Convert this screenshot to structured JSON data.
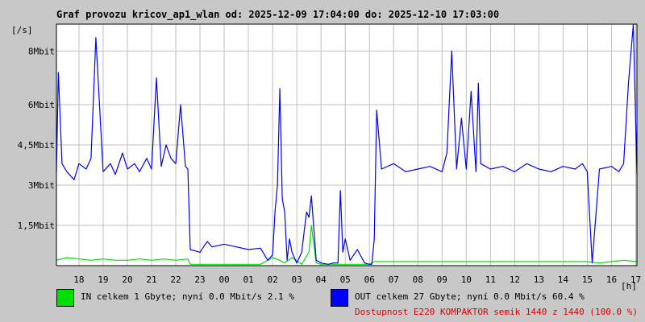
{
  "header": {
    "title": "Graf provozu kricov_ap1_wlan od: 2025-12-09 17:04:00 do: 2025-12-10 17:03:00"
  },
  "chart_data": {
    "type": "line",
    "ylabel": "[/s]",
    "xunit": "[h]",
    "ylim": [
      0,
      9
    ],
    "yticks": [
      {
        "value": 1.5,
        "label": "1,5Mbit"
      },
      {
        "value": 3,
        "label": "3Mbit"
      },
      {
        "value": 4.5,
        "label": "4,5Mbit"
      },
      {
        "value": 6,
        "label": "6Mbit"
      },
      {
        "value": 8,
        "label": "8Mbit"
      }
    ],
    "xlim": [
      17.07,
      41.05
    ],
    "xticks": [
      {
        "value": 18,
        "label": "18"
      },
      {
        "value": 19,
        "label": "19"
      },
      {
        "value": 20,
        "label": "20"
      },
      {
        "value": 21,
        "label": "21"
      },
      {
        "value": 22,
        "label": "22"
      },
      {
        "value": 23,
        "label": "23"
      },
      {
        "value": 24,
        "label": "00"
      },
      {
        "value": 25,
        "label": "01"
      },
      {
        "value": 26,
        "label": "02"
      },
      {
        "value": 27,
        "label": "03"
      },
      {
        "value": 28,
        "label": "04"
      },
      {
        "value": 29,
        "label": "05"
      },
      {
        "value": 30,
        "label": "06"
      },
      {
        "value": 31,
        "label": "07"
      },
      {
        "value": 32,
        "label": "08"
      },
      {
        "value": 33,
        "label": "09"
      },
      {
        "value": 34,
        "label": "10"
      },
      {
        "value": 35,
        "label": "11"
      },
      {
        "value": 36,
        "label": "12"
      },
      {
        "value": 37,
        "label": "13"
      },
      {
        "value": 38,
        "label": "14"
      },
      {
        "value": 39,
        "label": "15"
      },
      {
        "value": 40,
        "label": "16"
      },
      {
        "value": 41,
        "label": "17"
      }
    ],
    "grid": true,
    "series": [
      {
        "name": "IN",
        "color": "#00e000",
        "x": [
          17.07,
          17.5,
          18,
          18.5,
          19,
          19.5,
          20,
          20.5,
          21,
          21.5,
          22,
          22.5,
          22.6,
          23,
          24,
          25,
          25.5,
          26,
          26.3,
          26.5,
          26.8,
          27.2,
          27.5,
          27.6,
          27.8,
          28,
          29,
          30,
          30.2,
          31,
          32,
          33,
          34,
          35,
          36,
          37,
          38,
          39,
          39.5,
          40,
          40.5,
          41.05
        ],
        "values": [
          0.2,
          0.3,
          0.25,
          0.2,
          0.25,
          0.2,
          0.2,
          0.25,
          0.2,
          0.25,
          0.2,
          0.25,
          0.05,
          0.05,
          0.05,
          0.05,
          0.05,
          0.3,
          0.2,
          0.1,
          0.3,
          0.05,
          0.5,
          1.5,
          0.1,
          0.05,
          0.05,
          0.05,
          0.15,
          0.15,
          0.15,
          0.15,
          0.15,
          0.15,
          0.15,
          0.15,
          0.15,
          0.15,
          0.1,
          0.15,
          0.2,
          0.15
        ]
      },
      {
        "name": "OUT",
        "color": "#0000ff",
        "x": [
          17.07,
          17.15,
          17.3,
          17.5,
          17.8,
          18,
          18.3,
          18.5,
          18.7,
          19,
          19.3,
          19.5,
          19.8,
          20,
          20.3,
          20.5,
          20.8,
          21,
          21.2,
          21.4,
          21.6,
          21.8,
          22,
          22.2,
          22.4,
          22.5,
          22.6,
          22.8,
          23,
          23.3,
          23.5,
          24,
          24.5,
          25,
          25.5,
          25.8,
          26,
          26.1,
          26.2,
          26.3,
          26.4,
          26.5,
          26.6,
          26.7,
          26.8,
          27,
          27.2,
          27.4,
          27.5,
          27.6,
          27.8,
          28,
          28.3,
          28.5,
          28.7,
          28.8,
          28.9,
          29,
          29.2,
          29.5,
          29.8,
          30,
          30.1,
          30.2,
          30.3,
          30.5,
          31,
          31.5,
          32,
          32.5,
          33,
          33.2,
          33.4,
          33.6,
          33.8,
          34,
          34.2,
          34.4,
          34.5,
          34.6,
          35,
          35.5,
          36,
          36.5,
          37,
          37.5,
          38,
          38.5,
          38.8,
          39,
          39.2,
          39.5,
          40,
          40.3,
          40.5,
          40.7,
          40.9,
          41.05
        ],
        "values": [
          3.5,
          7.2,
          3.8,
          3.5,
          3.2,
          3.8,
          3.6,
          4.0,
          8.5,
          3.5,
          3.8,
          3.4,
          4.2,
          3.6,
          3.8,
          3.5,
          4.0,
          3.6,
          7.0,
          3.7,
          4.5,
          4.0,
          3.8,
          6.0,
          3.7,
          3.6,
          0.6,
          0.55,
          0.5,
          0.9,
          0.7,
          0.8,
          0.7,
          0.6,
          0.65,
          0.2,
          0.4,
          2.0,
          3.0,
          6.6,
          2.5,
          2.0,
          0.2,
          1.0,
          0.5,
          0.1,
          0.5,
          2.0,
          1.8,
          2.6,
          0.2,
          0.1,
          0.05,
          0.1,
          0.1,
          2.8,
          0.5,
          1.0,
          0.2,
          0.6,
          0.1,
          0.05,
          0.05,
          1.0,
          5.8,
          3.6,
          3.8,
          3.5,
          3.6,
          3.7,
          3.5,
          4.2,
          8.0,
          3.6,
          5.5,
          3.6,
          6.5,
          3.5,
          6.8,
          3.8,
          3.6,
          3.7,
          3.5,
          3.8,
          3.6,
          3.5,
          3.7,
          3.6,
          3.8,
          3.5,
          0.1,
          3.6,
          3.7,
          3.5,
          3.8,
          6.8,
          9.0,
          3.4
        ]
      }
    ]
  },
  "legend": {
    "in_color": "#00e000",
    "out_color": "#0000ff",
    "in_text": "IN celkem 1 Gbyte; nyní   0.0 Mbit/s 2.1 %",
    "out_text": "OUT celkem 27 Gbyte; nyní   0.0 Mbit/s 60.4 %"
  },
  "availability": {
    "text": "Dostupnost E220 KOMPAKTOR semik 1440 z 1440 (100.0 %)",
    "color": "#e00000"
  }
}
